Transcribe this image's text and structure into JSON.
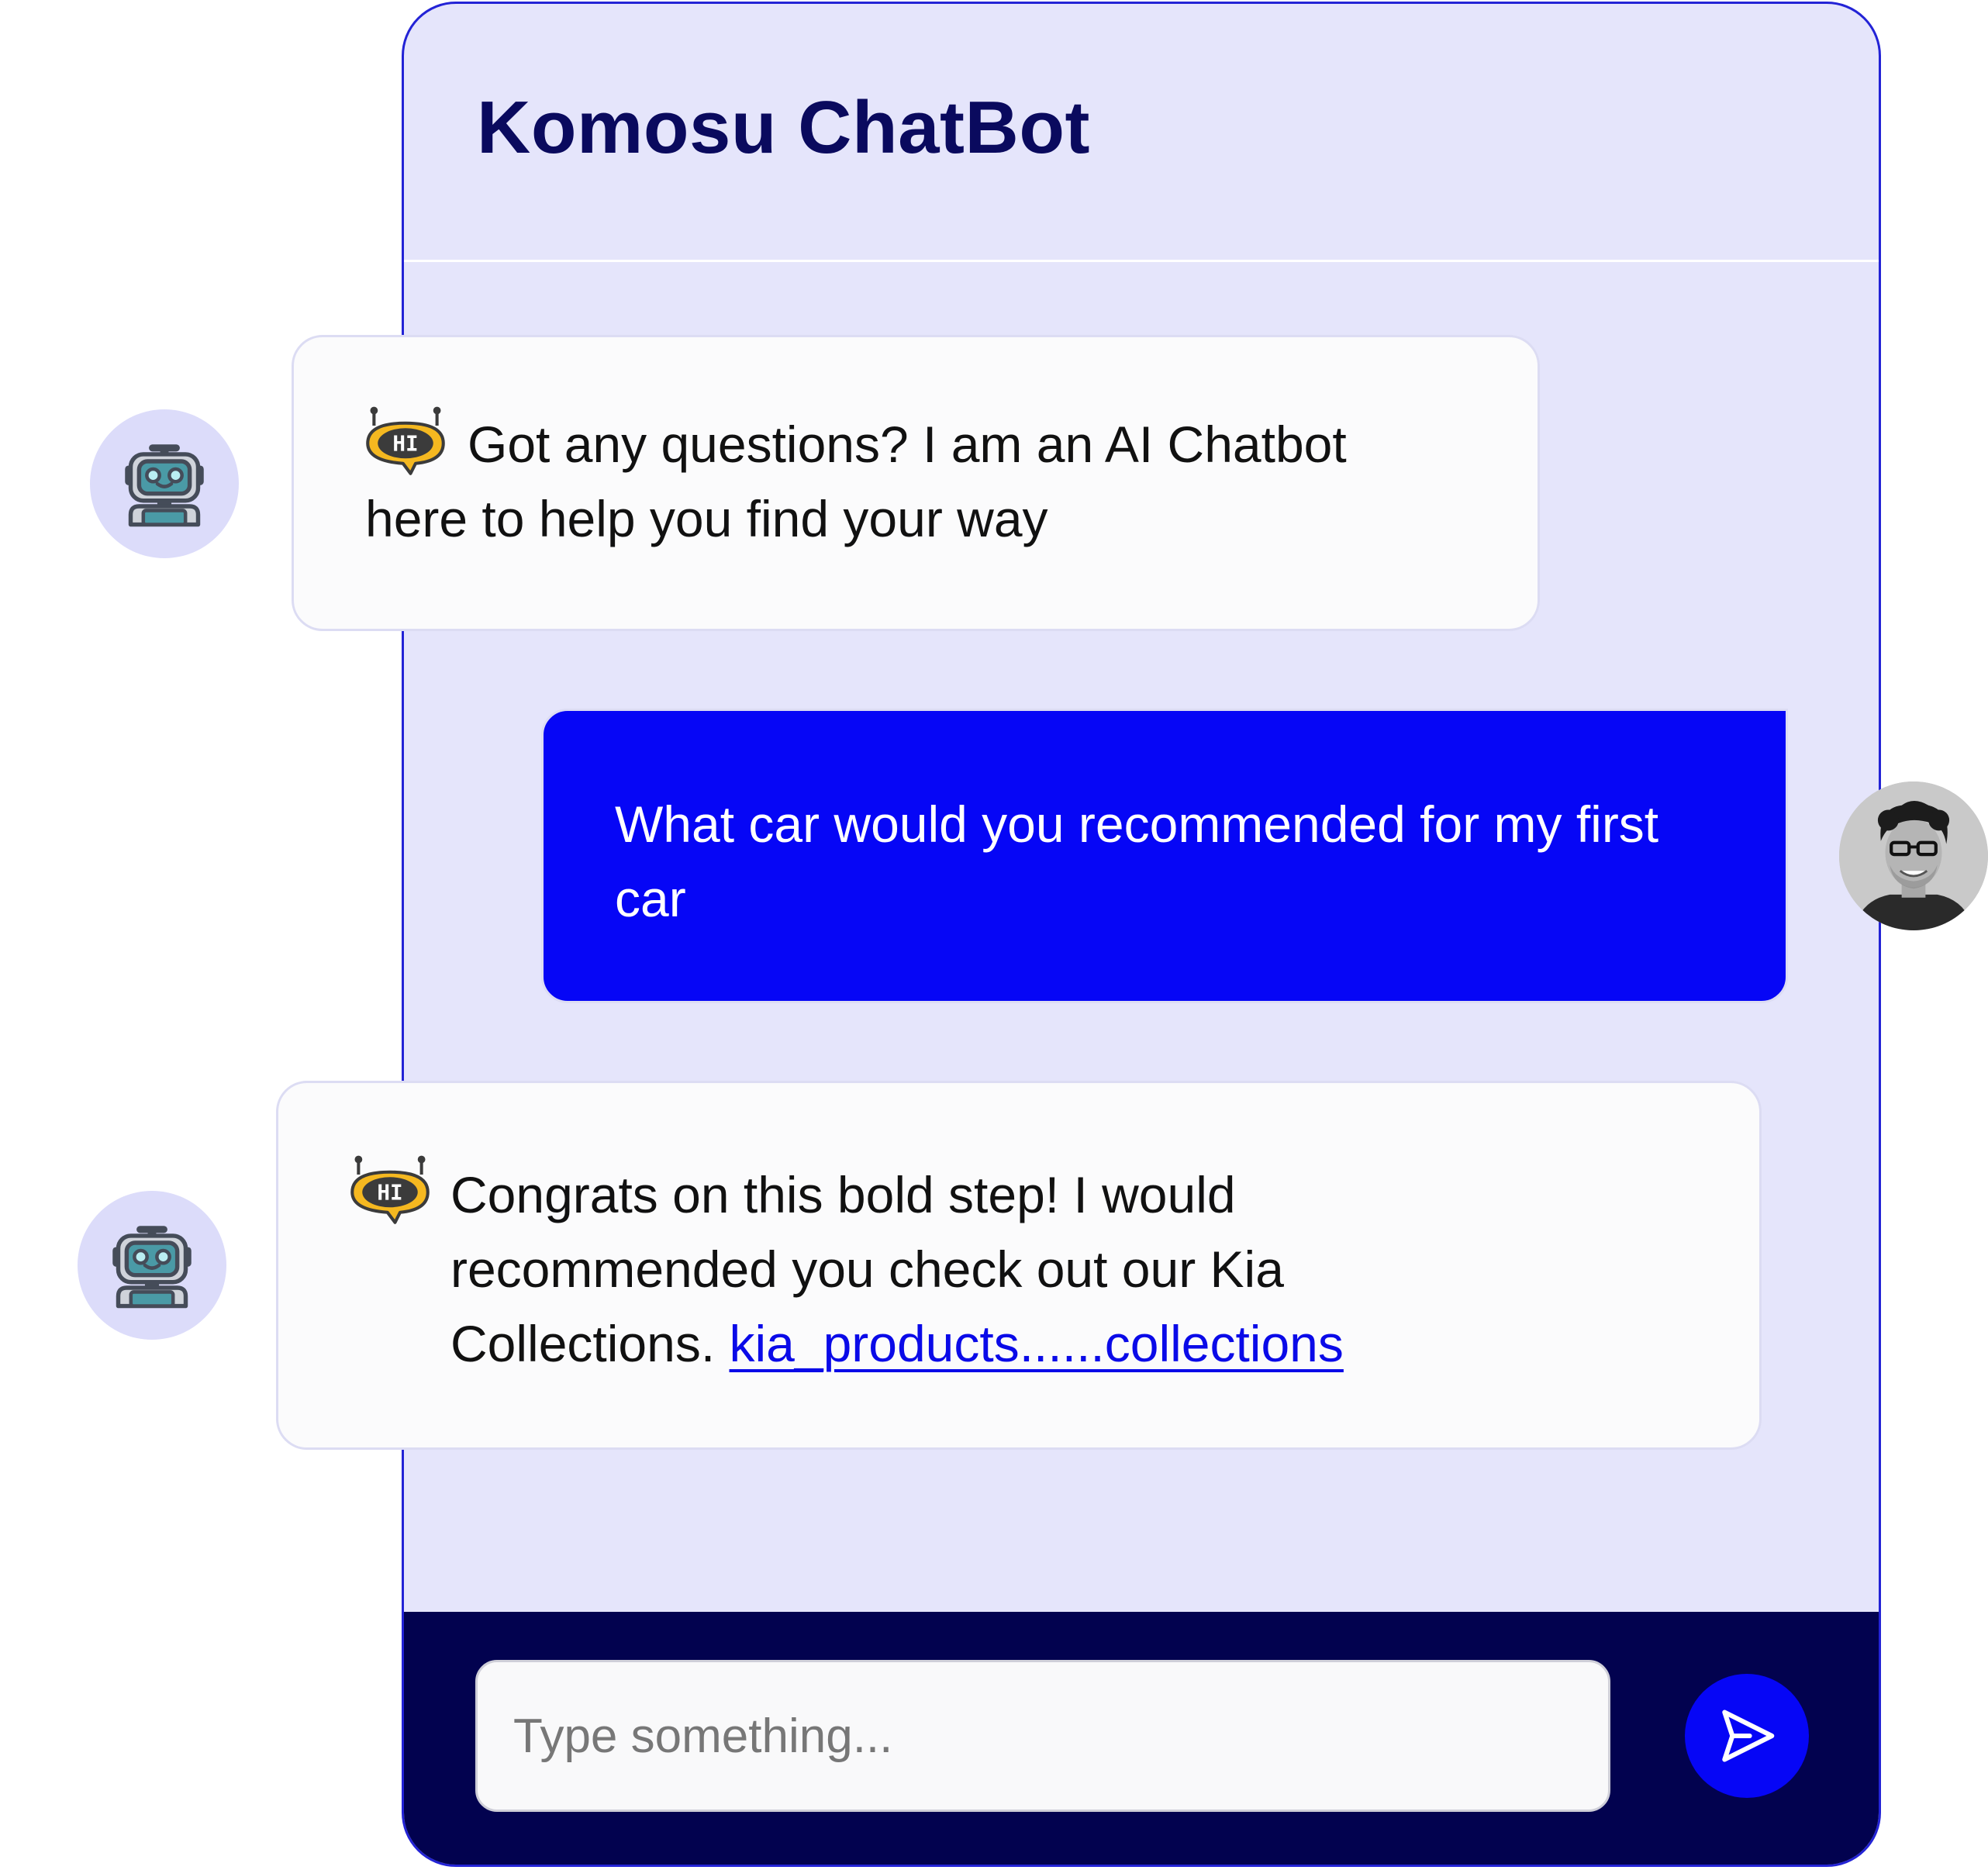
{
  "header": {
    "title": "Komosu ChatBot"
  },
  "messages": [
    {
      "sender": "bot",
      "emoji_text": "HI",
      "text": "Got any questions? I am an AI Chatbot here to help you find your way"
    },
    {
      "sender": "user",
      "text": "What car would you recommended for my first car"
    },
    {
      "sender": "bot",
      "emoji_text": "HI",
      "text": "Congrats on this bold step! I would recommended you check out our Kia Collections.",
      "link_text": "kia_products......collections"
    }
  ],
  "composer": {
    "placeholder": "Type something...",
    "value": "",
    "send_icon": "send-icon"
  },
  "icons": {
    "bot_avatar": "robot-icon",
    "bubble_emoji": "hi-robot-emoji-icon",
    "user_avatar": "user-photo"
  },
  "colors": {
    "window_background": "#e5e5fb",
    "window_border": "#2323d6",
    "title_text": "#0a0a5e",
    "user_bubble": "#0606f6",
    "bot_bubble": "#fbfbfc",
    "composer_background": "#02024f",
    "send_button": "#0606f6",
    "link": "#0a0ae8",
    "avatar_background": "#dcdcfa"
  }
}
